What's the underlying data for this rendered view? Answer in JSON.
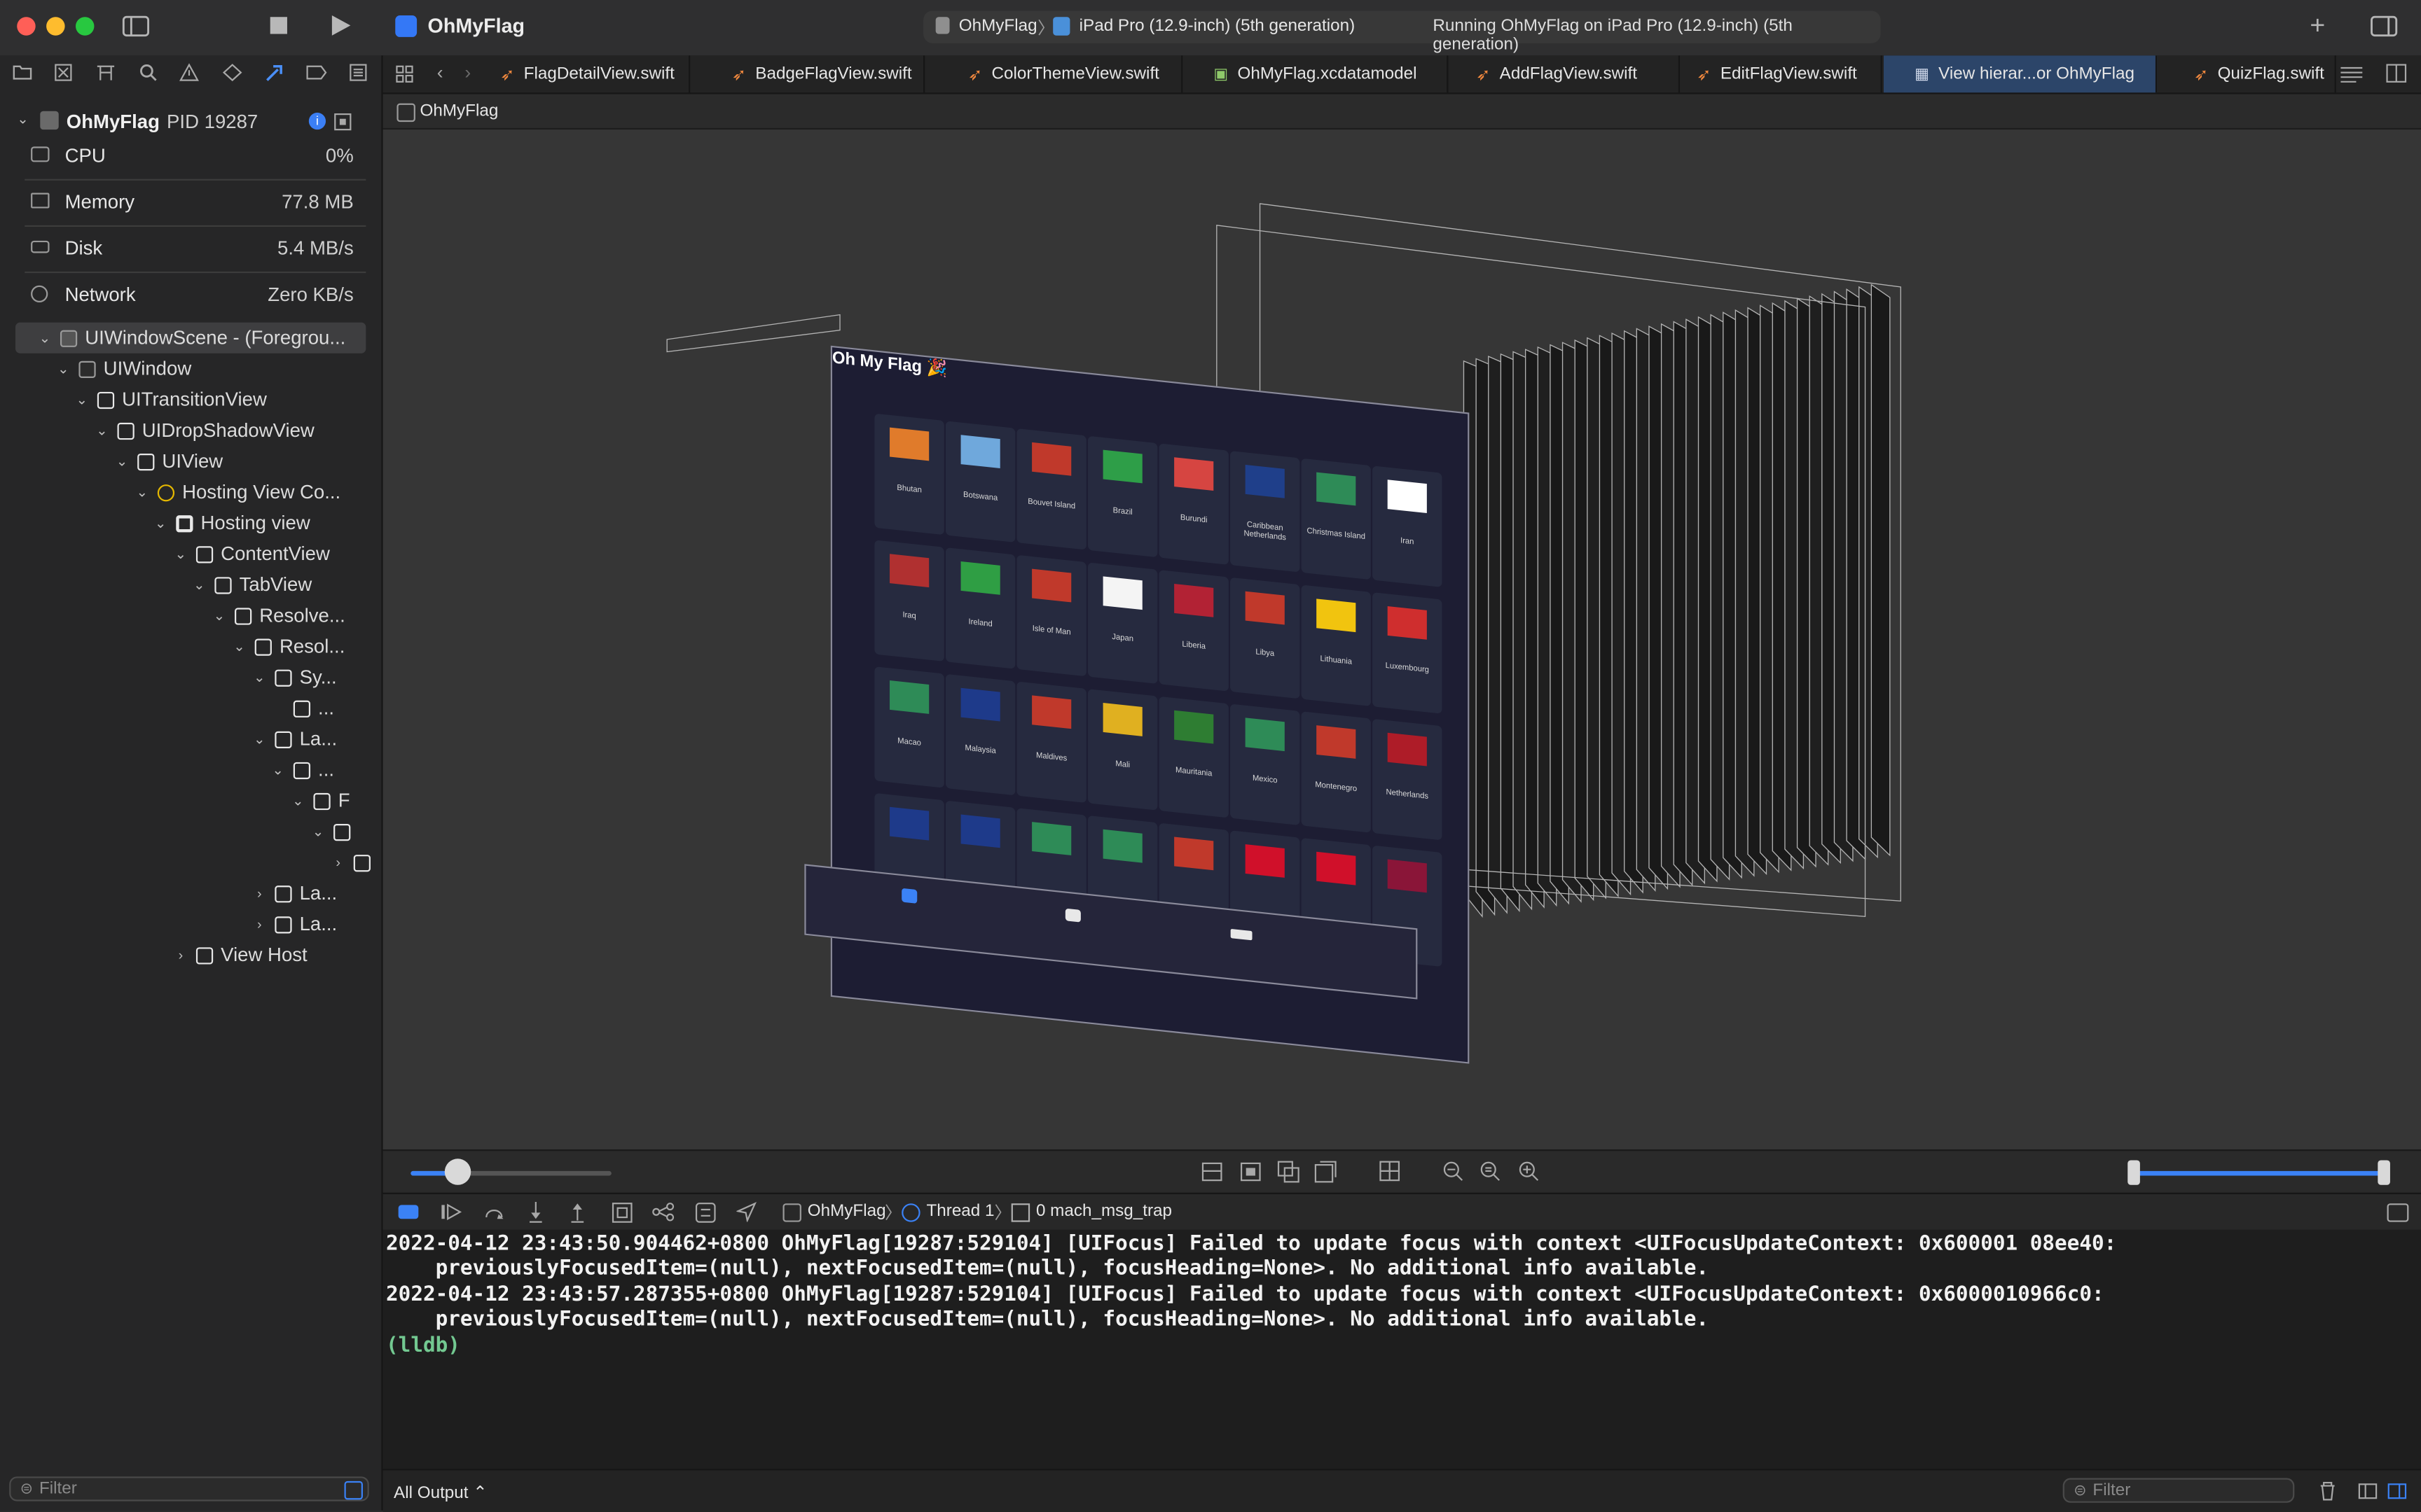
{
  "titlebar": {
    "project": "OhMyFlag",
    "scheme": "OhMyFlag",
    "destination": "iPad Pro (12.9-inch) (5th generation)",
    "status": "Running OhMyFlag on iPad Pro (12.9-inch) (5th generation)"
  },
  "sidebar": {
    "process": {
      "name": "OhMyFlag",
      "pid": "PID 19287"
    },
    "gauges": [
      {
        "label": "CPU",
        "value": "0%"
      },
      {
        "label": "Memory",
        "value": "77.8 MB"
      },
      {
        "label": "Disk",
        "value": "5.4 MB/s"
      },
      {
        "label": "Network",
        "value": "Zero KB/s"
      }
    ],
    "tree": [
      "UIWindowScene - (Foregrou...",
      "UIWindow",
      "UITransitionView",
      "UIDropShadowView",
      "UIView",
      "Hosting View Co...",
      "Hosting view",
      "ContentView",
      "TabView",
      "Resolve...",
      "Resol...",
      "Sy...",
      "...",
      "La...",
      "...",
      "F",
      "",
      "",
      "La...",
      "La...",
      "View Host"
    ],
    "filter_placeholder": "Filter"
  },
  "editor_tabs": [
    "FlagDetailView.swift",
    "BadgeFlagView.swift",
    "ColorThemeView.swift",
    "OhMyFlag.xcdatamodel",
    "AddFlagView.swift",
    "EditFlagView.swift",
    "View hierar...or OhMyFlag",
    "QuizFlag.swift"
  ],
  "jumpbar": {
    "crumb": "OhMyFlag"
  },
  "canvas": {
    "app_title": "Oh My Flag 🎉",
    "countries": [
      "Bhutan",
      "Botswana",
      "Bouvet Island",
      "Brazil",
      "Burundi",
      "Caribbean Netherlands",
      "Christmas Island",
      "Iran",
      "Iraq",
      "Ireland",
      "Isle of Man",
      "Japan",
      "Liberia",
      "Libya",
      "Lithuania",
      "Luxembourg",
      "Macao",
      "Malaysia",
      "Maldives",
      "Mali",
      "Mauritania",
      "Mexico",
      "Montenegro",
      "Netherlands",
      "",
      "",
      "",
      "",
      "",
      "",
      "",
      ""
    ]
  },
  "debugbar": {
    "process": "OhMyFlag",
    "thread": "Thread 1",
    "frame": "0 mach_msg_trap"
  },
  "console": {
    "lines": [
      "2022-04-12 23:43:50.904462+0800 OhMyFlag[19287:529104] [UIFocus] Failed to update focus with context <UIFocusUpdateContext: 0x600001 08ee40:",
      "    previouslyFocusedItem=(null), nextFocusedItem=(null), focusHeading=None>. No additional info available.",
      "2022-04-12 23:43:57.287355+0800 OhMyFlag[19287:529104] [UIFocus] Failed to update focus with context <UIFocusUpdateContext: 0x6000010966c0:",
      "    previouslyFocusedItem=(null), nextFocusedItem=(null), focusHeading=None>. No additional info available."
    ],
    "prompt": "(lldb)"
  },
  "footer": {
    "output_menu": "All Output ⌃",
    "filter_placeholder": "Filter"
  },
  "colors": {
    "accent": "#3b82f6",
    "swift": "#f0883e",
    "lldb": "#73c991"
  }
}
